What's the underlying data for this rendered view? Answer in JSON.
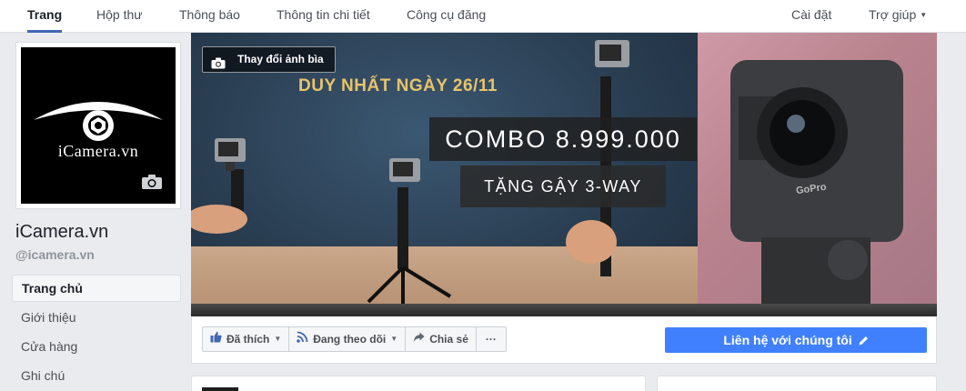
{
  "nav": {
    "tabs": [
      {
        "label": "Trang"
      },
      {
        "label": "Hộp thư"
      },
      {
        "label": "Thông báo"
      },
      {
        "label": "Thông tin chi tiết"
      },
      {
        "label": "Công cụ đăng"
      }
    ],
    "settings": "Cài đặt",
    "help": "Trợ giúp"
  },
  "profile": {
    "logo_text": "iCamera.vn",
    "name": "iCamera.vn",
    "handle": "@icamera.vn"
  },
  "sidebar": {
    "items": [
      {
        "label": "Trang chủ"
      },
      {
        "label": "Giới thiệu"
      },
      {
        "label": "Cửa hàng"
      },
      {
        "label": "Ghi chú"
      }
    ]
  },
  "cover": {
    "change_label": "Thay đổi ảnh bìa",
    "promo_date": "DUY NHẤT NGÀY 26/11",
    "promo_combo": "COMBO 8.999.000",
    "promo_gift": "TẶNG GẬY 3-WAY",
    "brand_mark": "GoPro"
  },
  "actions": {
    "liked": "Đã thích",
    "following": "Đang theo dõi",
    "share": "Chia sẻ",
    "more": "···",
    "contact": "Liên hệ với chúng tôi"
  },
  "colors": {
    "accent": "#4267b2",
    "primary_button": "#4080ff",
    "page_bg": "#e9ebee"
  }
}
